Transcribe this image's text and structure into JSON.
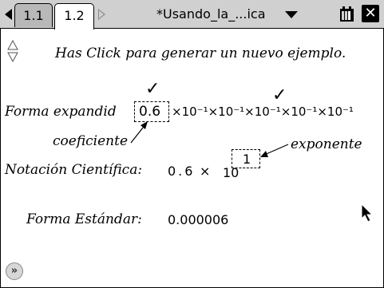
{
  "tabs": [
    {
      "label": "1.1",
      "active": false
    },
    {
      "label": "1.2",
      "active": true
    }
  ],
  "document_title": "*Usando_la_...ica",
  "icons": {
    "nav_left": "triangle-left-icon",
    "nav_right": "triangle-right-icon",
    "dropdown": "chevron-down-icon",
    "battery": "battery-icon",
    "close": "close-icon",
    "scroll": "up-down-arrows-icon",
    "check": "checkmark-icon",
    "cursor": "pointer-cursor-icon",
    "expand": "double-chevron-right-icon"
  },
  "instruction": "Has Click para generar un nuevo ejemplo.",
  "expanded": {
    "label": "Forma expandid",
    "coefficient": "0.6",
    "factors": "×10⁻¹×10⁻¹×10⁻¹×10⁻¹×10⁻¹",
    "check_mark": "✓"
  },
  "annotations": {
    "coefficient_label": "coeficiente",
    "exponent_label": "exponente"
  },
  "scientific": {
    "label": "Notación Científica:",
    "mantissa": "0.6",
    "times": "×",
    "base": "10",
    "exponent": "1"
  },
  "standard": {
    "label": "Forma Estándar:",
    "value": "0.000006"
  },
  "expand_button_glyph": "»"
}
